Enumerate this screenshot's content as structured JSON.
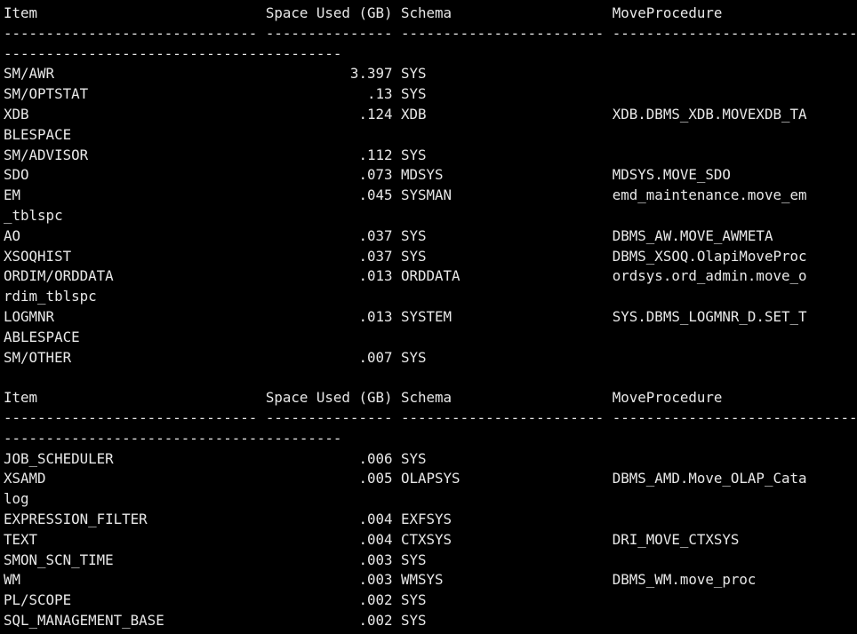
{
  "terminal": {
    "lines": [
      "Item                           Space Used (GB) Schema                   MoveProcedure",
      "------------------------------ --------------- ------------------------ -----------------------------",
      "----------------------------------------",
      "SM/AWR                                   3.397 SYS",
      "SM/OPTSTAT                                 .13 SYS",
      "XDB                                       .124 XDB                      XDB.DBMS_XDB.MOVEXDB_TA",
      "BLESPACE",
      "SM/ADVISOR                                .112 SYS",
      "SDO                                       .073 MDSYS                    MDSYS.MOVE_SDO",
      "EM                                        .045 SYSMAN                   emd_maintenance.move_em",
      "_tblspc",
      "AO                                        .037 SYS                      DBMS_AW.MOVE_AWMETA",
      "XSOQHIST                                  .037 SYS                      DBMS_XSOQ.OlapiMoveProc",
      "ORDIM/ORDDATA                             .013 ORDDATA                  ordsys.ord_admin.move_o",
      "rdim_tblspc",
      "LOGMNR                                    .013 SYSTEM                   SYS.DBMS_LOGMNR_D.SET_T",
      "ABLESPACE",
      "SM/OTHER                                  .007 SYS",
      "",
      "Item                           Space Used (GB) Schema                   MoveProcedure",
      "------------------------------ --------------- ------------------------ -----------------------------",
      "----------------------------------------",
      "JOB_SCHEDULER                             .006 SYS",
      "XSAMD                                     .005 OLAPSYS                  DBMS_AMD.Move_OLAP_Cata",
      "log",
      "EXPRESSION_FILTER                         .004 EXFSYS",
      "TEXT                                      .004 CTXSYS                   DRI_MOVE_CTXSYS",
      "SMON_SCN_TIME                             .003 SYS",
      "WM                                        .003 WMSYS                    DBMS_WM.move_proc",
      "PL/SCOPE                                  .002 SYS",
      "SQL_MANAGEMENT_BASE                       .002 SYS"
    ]
  }
}
